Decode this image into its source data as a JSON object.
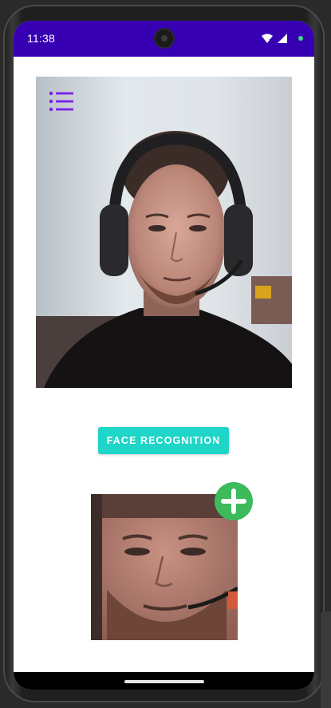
{
  "status_bar": {
    "time": "11:38",
    "color": "#3700b3",
    "icons": [
      "camera-cutout",
      "wifi-icon",
      "signal-icon",
      "notification-dot"
    ]
  },
  "main": {
    "menu_icon": "list-icon",
    "face_button_label": "Face Recognition",
    "accent_color": "#7b1fe8",
    "button_color": "#1ed5c8",
    "fab_icon": "plus-icon",
    "fab_color": "#3cba5c"
  }
}
